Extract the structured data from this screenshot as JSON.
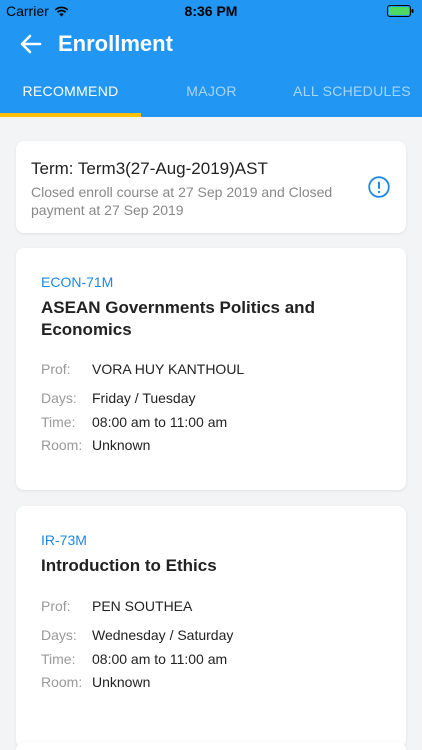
{
  "status": {
    "carrier": "Carrier",
    "time": "8:36 PM"
  },
  "appbar": {
    "title": "Enrollment"
  },
  "tabs": [
    {
      "label": "RECOMMEND",
      "active": true
    },
    {
      "label": "MAJOR",
      "active": false
    },
    {
      "label": "ALL SCHEDULES",
      "active": false
    }
  ],
  "term": {
    "title": "Term: Term3(27-Aug-2019)AST",
    "description": "Closed enroll course at 27 Sep 2019 and Closed payment at 27 Sep 2019"
  },
  "labels": {
    "prof": "Prof:",
    "days": "Days:",
    "time": "Time:",
    "room": "Room:"
  },
  "courses": [
    {
      "code": "ECON-71M",
      "name": "ASEAN Governments Politics and Economics",
      "prof": "VORA HUY KANTHOUL",
      "days": "Friday / Tuesday",
      "time": "08:00 am to 11:00 am",
      "room": "Unknown"
    },
    {
      "code": "IR-73M",
      "name": "Introduction to Ethics",
      "prof": "PEN SOUTHEA",
      "days": "Wednesday / Saturday",
      "time": "08:00 am to 11:00 am",
      "room": "Unknown"
    }
  ],
  "colors": {
    "primary": "#2196f3",
    "indicator": "#ffc107",
    "code": "#1e88e5"
  }
}
